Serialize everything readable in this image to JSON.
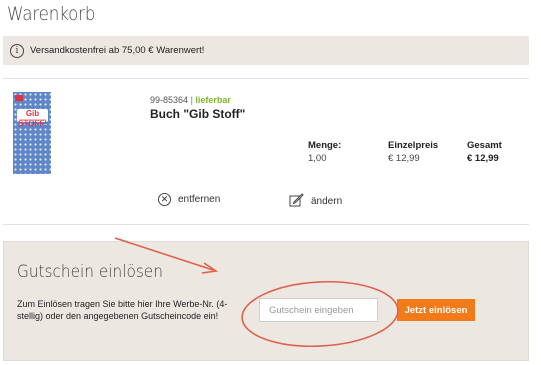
{
  "page": {
    "title": "Warenkorb"
  },
  "info_bar": {
    "icon": "info-icon",
    "text": "Versandkostenfrei ab 75,00 € Warenwert!"
  },
  "product": {
    "image_label": "Gib STOFF!",
    "article_number": "99-85364",
    "separator": "|",
    "availability": "lieferbar",
    "name": "Buch \"Gib Stoff\"",
    "columns": {
      "quantity": {
        "header": "Menge:",
        "value": "1,00"
      },
      "unit_price": {
        "header": "Einzelpreis",
        "value": "€ 12,99"
      },
      "total": {
        "header": "Gesamt",
        "value": "€ 12,99"
      }
    },
    "actions": {
      "remove": {
        "icon": "close-circle-icon",
        "label": "entfernen"
      },
      "edit": {
        "icon": "edit-icon",
        "label": "ändern"
      }
    }
  },
  "voucher": {
    "title": "Gutschein einlösen",
    "description": "Zum Einlösen tragen Sie bitte hier Ihre Werbe-Nr. (4-stellig) oder den angegebenen Gutscheincode ein!",
    "input_placeholder": "Gutschein eingeben",
    "input_value": "",
    "button_label": "Jetzt einlösen"
  },
  "colors": {
    "accent_orange": "#f27a18",
    "availability_green": "#7fb52f",
    "info_background": "#ece7e1",
    "annotation_red": "#e0604e"
  }
}
